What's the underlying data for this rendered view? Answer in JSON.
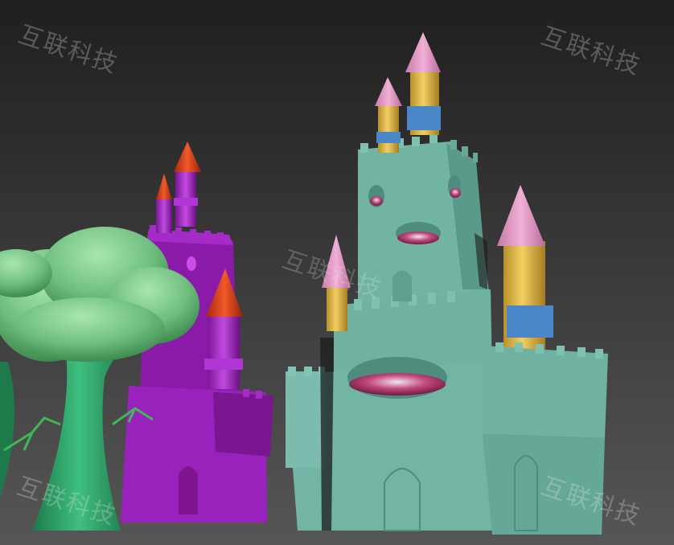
{
  "watermark": {
    "text_1": "互联科技",
    "text_2": "互联科技",
    "text_3": "互联科技",
    "text_4": "互联科技",
    "text_5": "互联科技"
  },
  "colors": {
    "background_top": "#1e1e1e",
    "background_bottom": "#555555",
    "teal_castle": "#6fb2a2",
    "teal_castle_dark": "#4f8c7e",
    "purple_castle": "#9a1fb8",
    "purple_castle_dark": "#6e1585",
    "yellow_tower": "#e0b84a",
    "pink_roof": "#e79cc8",
    "red_roof": "#d83a1e",
    "blue_band": "#4a86c8",
    "tree_canopy": "#79c88a",
    "tree_trunk": "#2fa06a"
  }
}
